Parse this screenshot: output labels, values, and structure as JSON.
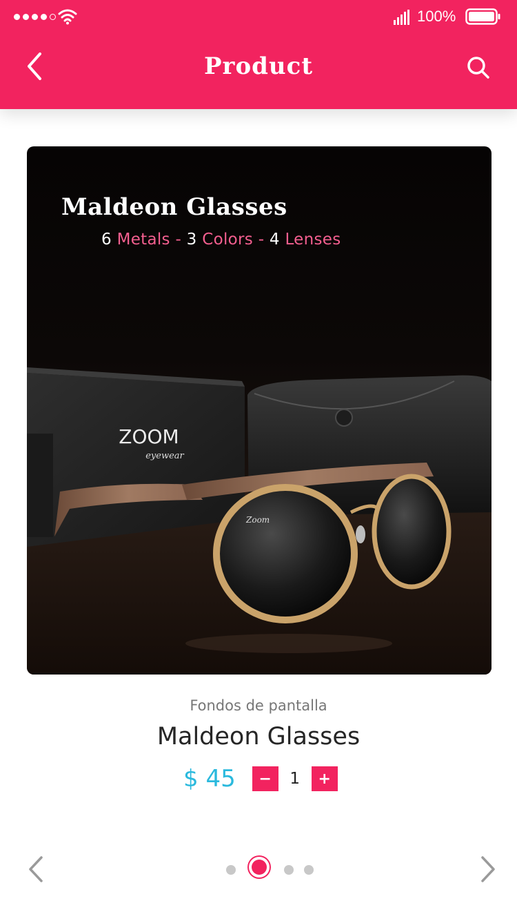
{
  "status_bar": {
    "battery": "100%"
  },
  "header": {
    "title": "Product"
  },
  "card": {
    "title": "Maldeon Glasses",
    "subtitle": {
      "metals_count": "6",
      "metals_label": "Metals",
      "colors_count": "3",
      "colors_label": "Colors",
      "lenses_count": "4",
      "lenses_label": "Lenses",
      "separator": " - "
    },
    "box_brand": "ZOOM",
    "box_brand_sub": "eyewear",
    "lens_logo": "Zoom"
  },
  "product": {
    "category": "Fondos de pantalla",
    "name": "Maldeon Glasses",
    "price": "$ 45",
    "quantity": "1",
    "minus_label": "−",
    "plus_label": "+"
  },
  "pager": {
    "total": 4,
    "active_index": 1
  },
  "colors": {
    "accent": "#f2235f",
    "price": "#2ab9dd",
    "highlight": "#f35f8f"
  },
  "icons": {
    "back": "chevron-left-icon",
    "search": "search-icon",
    "prev": "chevron-left-icon",
    "next": "chevron-right-icon"
  }
}
